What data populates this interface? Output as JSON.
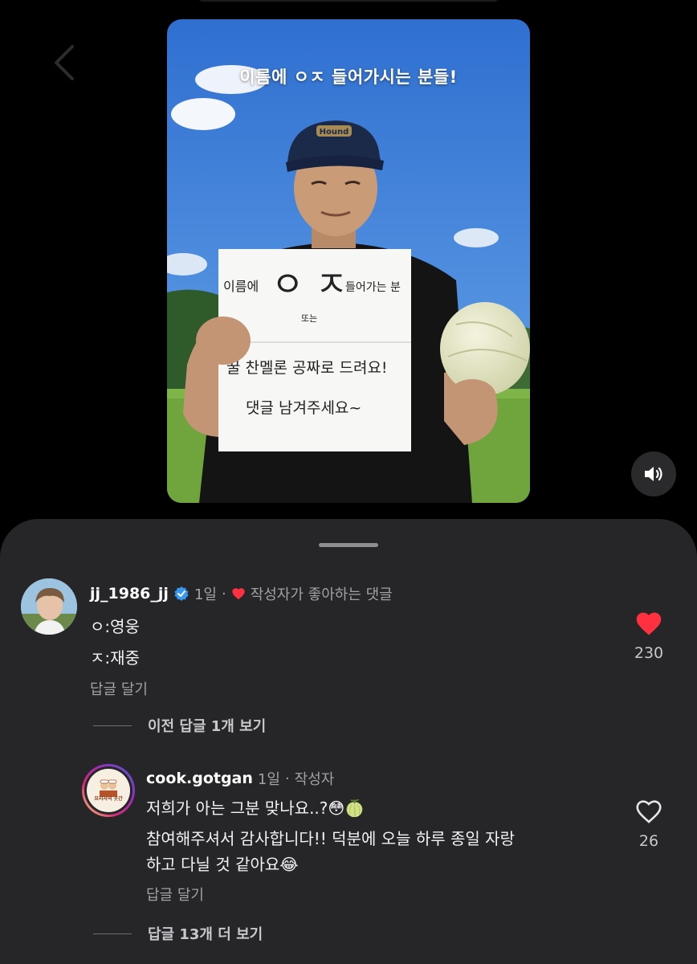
{
  "video": {
    "caption": "이름에 ㅇㅈ 들어가시는 분들!",
    "sign_line1": "이름에",
    "sign_big": "ㅇ ㅈ",
    "sign_line1_end": "들어가는 분",
    "sign_small": "또는",
    "sign_line2": "꿀 찬멜론 공짜로 드려요!",
    "sign_line3": "댓글 남겨주세요~",
    "cap_text": "Hound"
  },
  "comments": [
    {
      "username": "jj_1986_jj",
      "verified": true,
      "age": "1일",
      "separator": "·",
      "creator_liked_label": "작성자가 좋아하는 댓글",
      "lines": [
        "ㅇ:영웅",
        "ㅈ:재중"
      ],
      "reply_label": "답글 달기",
      "liked": true,
      "like_count": "230"
    }
  ],
  "view_previous_replies": "이전 답글 1개 보기",
  "reply": {
    "username": "cook.gotgan",
    "age": "1일",
    "separator": "·",
    "author_label": "작성자",
    "avatar_text": "요리사의 곳간",
    "lines": [
      "저희가 아는 그분 맞나요..?😳🍈",
      "참여해주셔서 감사합니다!! 덕분에 오늘 하루 종일 자랑",
      "하고 다닐 것 같아요😂"
    ],
    "reply_label": "답글 달기",
    "liked": false,
    "like_count": "26"
  },
  "view_more_replies": "답글 13개 더 보기",
  "colors": {
    "like_red": "#ff3040",
    "verified_blue": "#3897f0",
    "sheet_bg": "#262628"
  }
}
